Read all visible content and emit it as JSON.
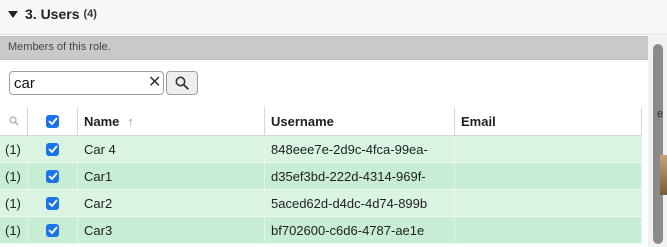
{
  "section": {
    "title": "3. Users",
    "count": "(4)"
  },
  "subheader": {
    "text": "Members of this role."
  },
  "search": {
    "value": "car",
    "clear_glyph": "✕"
  },
  "table": {
    "headers": {
      "name": "Name",
      "username": "Username",
      "email": "Email"
    },
    "rows": [
      {
        "idx": "(1)",
        "checked": true,
        "name": "Car 4",
        "username": "848eee7e-2d9c-4fca-99ea-",
        "email": ""
      },
      {
        "idx": "(1)",
        "checked": true,
        "name": "Car1",
        "username": "d35ef3bd-222d-4314-969f-",
        "email": ""
      },
      {
        "idx": "(1)",
        "checked": true,
        "name": "Car2",
        "username": "5aced62d-d4dc-4d74-899b",
        "email": ""
      },
      {
        "idx": "(1)",
        "checked": true,
        "name": "Car3",
        "username": "bf702600-c6d6-4787-ae1e",
        "email": ""
      }
    ]
  },
  "edge": {
    "text": "e"
  },
  "colors": {
    "accent": "#1a73e8",
    "row_bg": "#c7edd4",
    "row_alt_bg": "#d9f4e1",
    "subheader_bg": "#c9c9c9"
  },
  "icons": {
    "collapse": "triangle-down-icon",
    "search": "search-icon",
    "clear": "close-icon",
    "sort": "arrow-up-icon"
  }
}
